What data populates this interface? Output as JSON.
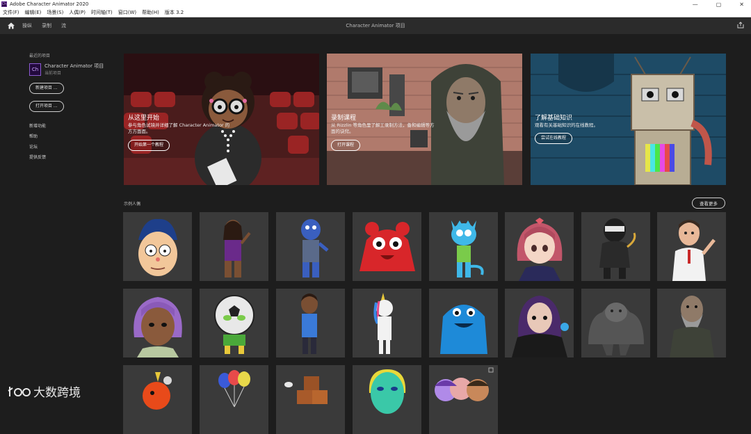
{
  "window": {
    "title": "Adobe Character Animator 2020"
  },
  "menu": [
    "文件(F)",
    "编辑(E)",
    "场景(S)",
    "人偶(P)",
    "时间轴(T)",
    "窗口(W)",
    "帮助(H)",
    "版本 3.2"
  ],
  "topbar": {
    "tabs": [
      "操纵",
      "录制",
      "流"
    ],
    "center_title": "Character Animator 项目"
  },
  "sidebar": {
    "recent_label": "最近的项目",
    "recent_project": {
      "name": "Character Animator 项目",
      "sub": "当前项目"
    },
    "new_project": "新建项目 ...",
    "open_project": "打开项目 ...",
    "links": [
      "新增功能",
      "帮助",
      "论坛",
      "提供反馈"
    ]
  },
  "banners": [
    {
      "title": "从这里开始",
      "desc": "参与角色试镜并详细了解 Character Animator 的方方面面。",
      "button": "开始第一个教程"
    },
    {
      "title": "录制课程",
      "desc": "从 Rizzlin 等角色里了解工录制方法，备和编辑等方面的诀窍。",
      "button": "打开课程"
    },
    {
      "title": "了解基础知识",
      "desc": "观看有关基础知识的在线教程。",
      "button": "尝试在线教程"
    }
  ],
  "examples": {
    "label": "示例人偶",
    "see_more": "查看更多"
  },
  "watermark": {
    "text": "大数跨境"
  },
  "colors": {
    "bg": "#1d1d1d",
    "topbar": "#2b2b2b",
    "card": "#3a3a3a",
    "accent": "#8c5bd1"
  }
}
